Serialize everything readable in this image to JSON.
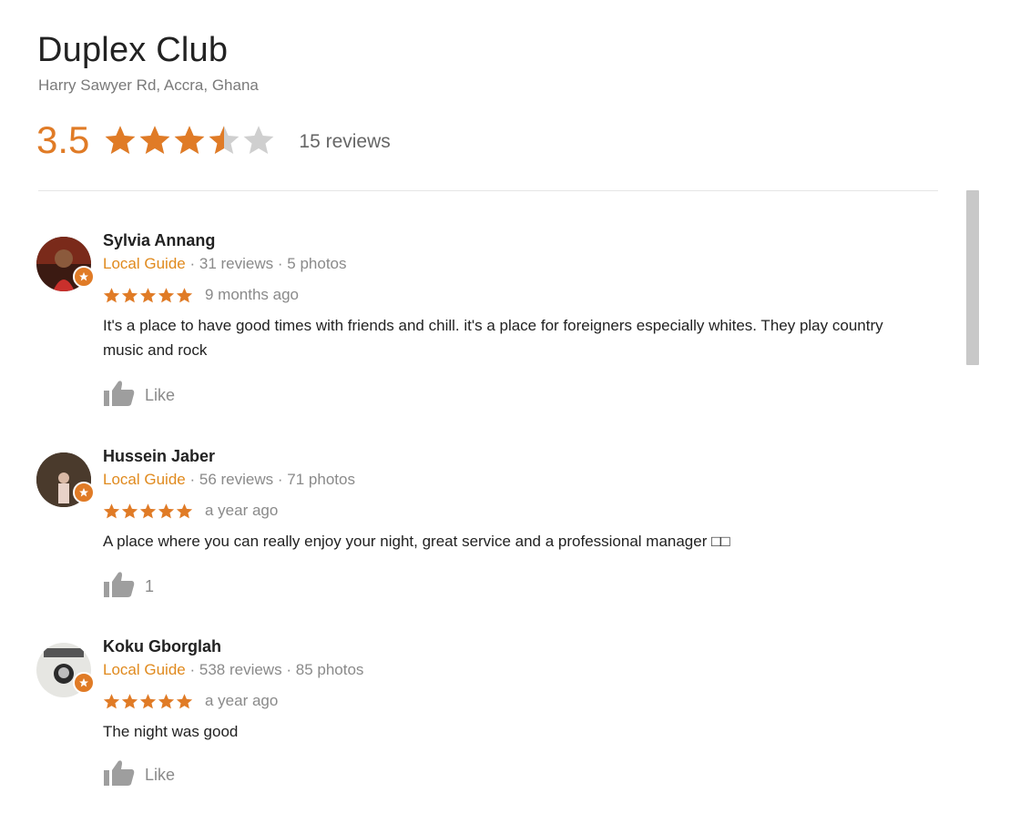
{
  "place": {
    "title": "Duplex Club",
    "address": "Harry Sawyer Rd, Accra, Ghana",
    "rating": 3.5,
    "rating_label": "3.5",
    "review_count_label": "15 reviews"
  },
  "colors": {
    "accent": "#e07b26",
    "local_guide": "#e08a1e",
    "empty_star": "#cfcfcf",
    "muted_text": "#8a8a8a"
  },
  "reviews": [
    {
      "name": "Sylvia Annang",
      "badge": "Local Guide",
      "reviews": "31 reviews",
      "photos": "5 photos",
      "stars": 5,
      "time": "9 months ago",
      "text": "It's a place to have good times with friends and chill. it's a place for foreigners especially whites. They play country music and rock",
      "like_label": "Like",
      "like_icon": "thumbs-up-icon"
    },
    {
      "name": "Hussein Jaber",
      "badge": "Local Guide",
      "reviews": "56 reviews",
      "photos": "71 photos",
      "stars": 5,
      "time": "a year ago",
      "text": "A place where you can really enjoy your night, great service and a professional manager □□",
      "like_label": "1",
      "like_icon": "thumbs-up-icon"
    },
    {
      "name": "Koku Gborglah",
      "badge": "Local Guide",
      "reviews": "538 reviews",
      "photos": "85 photos",
      "stars": 5,
      "time": "a year ago",
      "text": "The night was good",
      "like_label": "Like",
      "like_icon": "thumbs-up-icon"
    }
  ],
  "separator": "·"
}
